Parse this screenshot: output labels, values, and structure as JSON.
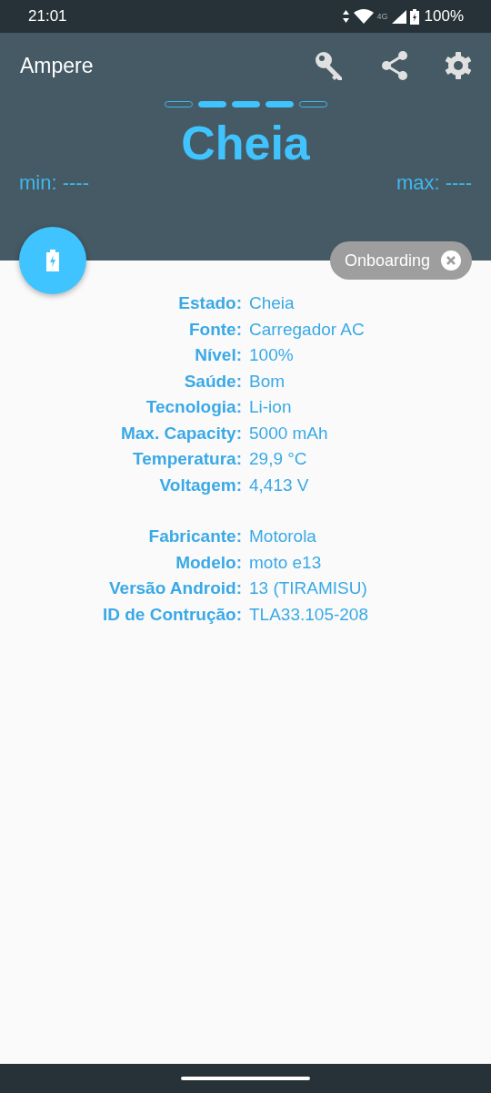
{
  "status_bar": {
    "time": "21:01",
    "network": "4G",
    "battery": "100%"
  },
  "app_bar": {
    "title": "Ampere",
    "actions": [
      {
        "kind": "key"
      },
      {
        "kind": "share"
      },
      {
        "kind": "settings"
      }
    ]
  },
  "level_indicator": [
    {
      "filled": false
    },
    {
      "filled": true
    },
    {
      "filled": true
    },
    {
      "filled": true
    },
    {
      "filled": false
    }
  ],
  "status_title": "Cheia",
  "min": "min: ----",
  "max": "max: ----",
  "chip": {
    "label": "Onboarding"
  },
  "info_groups": [
    [
      {
        "label": "Estado:",
        "value": "Cheia"
      },
      {
        "label": "Fonte:",
        "value": "Carregador AC"
      },
      {
        "label": "Nível:",
        "value": "100%"
      },
      {
        "label": "Saúde:",
        "value": "Bom"
      },
      {
        "label": "Tecnologia:",
        "value": "Li-ion"
      },
      {
        "label": "Max. Capacity:",
        "value": "5000 mAh"
      },
      {
        "label": "Temperatura:",
        "value": "29,9 °C"
      },
      {
        "label": "Voltagem:",
        "value": "4,413 V"
      }
    ],
    [
      {
        "label": "Fabricante:",
        "value": "Motorola"
      },
      {
        "label": "Modelo:",
        "value": "moto e13"
      },
      {
        "label": "Versão Android:",
        "value": "13 (TIRAMISU)"
      },
      {
        "label": "ID de Contrução:",
        "value": "TLA33.105-208"
      }
    ]
  ]
}
